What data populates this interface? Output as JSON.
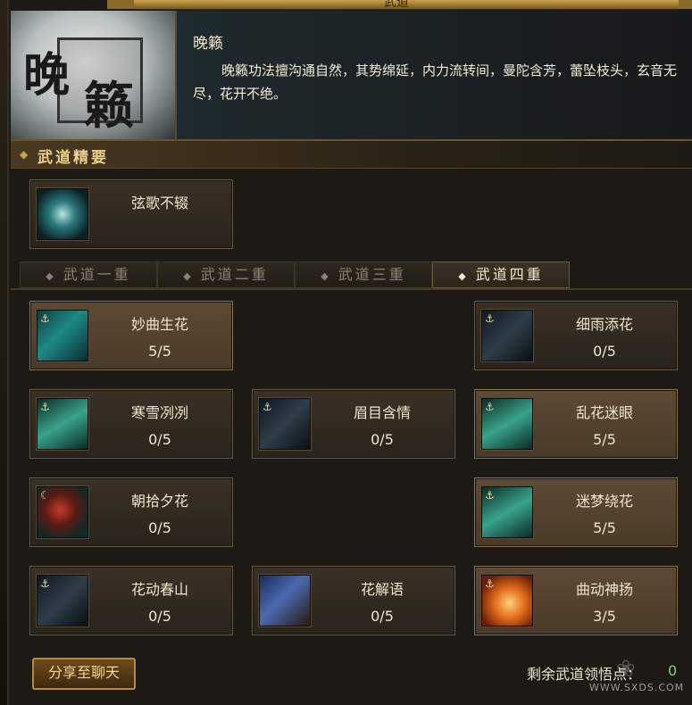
{
  "window": {
    "title": "武道"
  },
  "header": {
    "portrait_chars": [
      "晚",
      "籁"
    ],
    "style_name": "晚籁",
    "description": "晚籁功法擅沟通自然，其势绵延，内力流转间，曼陀含芳，蕾坠枝头，玄音无尽，花开不绝。"
  },
  "essentials": {
    "title": "武道精要",
    "skill": {
      "name": "弦歌不辍",
      "icon": "lyre-song-icon"
    }
  },
  "tabs": [
    "武道一重",
    "武道二重",
    "武道三重",
    "武道四重"
  ],
  "active_tab": 3,
  "skills": [
    {
      "name": "妙曲生花",
      "points": "5/5",
      "icon": "music-scroll-icon"
    },
    {
      "name": "细雨添花",
      "points": "0/5",
      "icon": "rain-flower-icon"
    },
    {
      "name": "寒雪冽冽",
      "points": "0/5",
      "icon": "snow-icon"
    },
    {
      "name": "眉目含情",
      "points": "0/5",
      "icon": "gaze-icon"
    },
    {
      "name": "乱花迷眼",
      "points": "5/5",
      "icon": "petal-wind-icon"
    },
    {
      "name": "朝拾夕花",
      "points": "0/5",
      "icon": "red-flower-icon"
    },
    {
      "name": "迷梦绕花",
      "points": "5/5",
      "icon": "dream-wind-icon"
    },
    {
      "name": "花动春山",
      "points": "0/5",
      "icon": "spring-mountain-icon"
    },
    {
      "name": "花解语",
      "points": "0/5",
      "icon": "flower-speech-icon"
    },
    {
      "name": "曲动神扬",
      "points": "3/5",
      "icon": "fire-swirl-icon"
    }
  ],
  "footer": {
    "share_label": "分享至聊天",
    "remaining_label": "剩余武道领悟点：",
    "remaining_value": "0",
    "watermark": "WWW.SXDS.COM"
  }
}
